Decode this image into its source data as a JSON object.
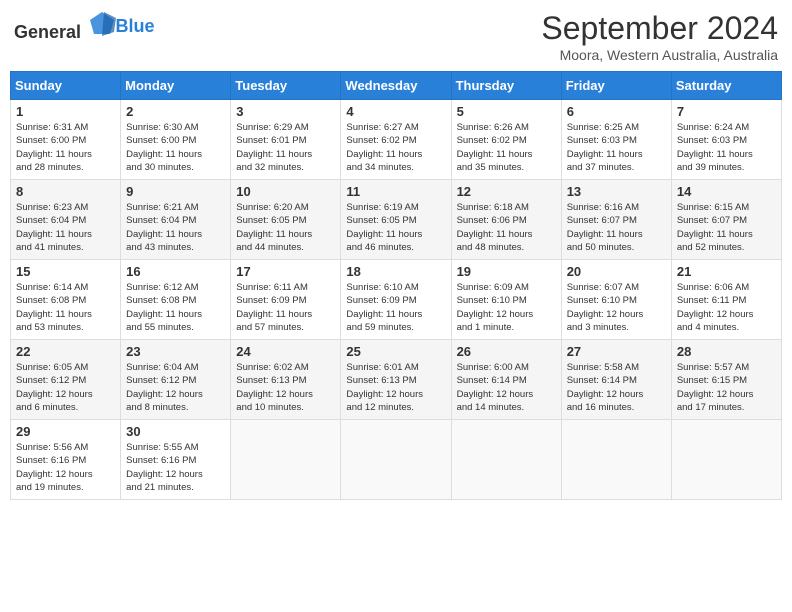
{
  "header": {
    "logo_general": "General",
    "logo_blue": "Blue",
    "month_title": "September 2024",
    "location": "Moora, Western Australia, Australia"
  },
  "weekdays": [
    "Sunday",
    "Monday",
    "Tuesday",
    "Wednesday",
    "Thursday",
    "Friday",
    "Saturday"
  ],
  "weeks": [
    [
      {
        "day": "1",
        "sunrise": "6:31 AM",
        "sunset": "6:00 PM",
        "daylight": "11 hours and 28 minutes."
      },
      {
        "day": "2",
        "sunrise": "6:30 AM",
        "sunset": "6:00 PM",
        "daylight": "11 hours and 30 minutes."
      },
      {
        "day": "3",
        "sunrise": "6:29 AM",
        "sunset": "6:01 PM",
        "daylight": "11 hours and 32 minutes."
      },
      {
        "day": "4",
        "sunrise": "6:27 AM",
        "sunset": "6:02 PM",
        "daylight": "11 hours and 34 minutes."
      },
      {
        "day": "5",
        "sunrise": "6:26 AM",
        "sunset": "6:02 PM",
        "daylight": "11 hours and 35 minutes."
      },
      {
        "day": "6",
        "sunrise": "6:25 AM",
        "sunset": "6:03 PM",
        "daylight": "11 hours and 37 minutes."
      },
      {
        "day": "7",
        "sunrise": "6:24 AM",
        "sunset": "6:03 PM",
        "daylight": "11 hours and 39 minutes."
      }
    ],
    [
      {
        "day": "8",
        "sunrise": "6:23 AM",
        "sunset": "6:04 PM",
        "daylight": "11 hours and 41 minutes."
      },
      {
        "day": "9",
        "sunrise": "6:21 AM",
        "sunset": "6:04 PM",
        "daylight": "11 hours and 43 minutes."
      },
      {
        "day": "10",
        "sunrise": "6:20 AM",
        "sunset": "6:05 PM",
        "daylight": "11 hours and 44 minutes."
      },
      {
        "day": "11",
        "sunrise": "6:19 AM",
        "sunset": "6:05 PM",
        "daylight": "11 hours and 46 minutes."
      },
      {
        "day": "12",
        "sunrise": "6:18 AM",
        "sunset": "6:06 PM",
        "daylight": "11 hours and 48 minutes."
      },
      {
        "day": "13",
        "sunrise": "6:16 AM",
        "sunset": "6:07 PM",
        "daylight": "11 hours and 50 minutes."
      },
      {
        "day": "14",
        "sunrise": "6:15 AM",
        "sunset": "6:07 PM",
        "daylight": "11 hours and 52 minutes."
      }
    ],
    [
      {
        "day": "15",
        "sunrise": "6:14 AM",
        "sunset": "6:08 PM",
        "daylight": "11 hours and 53 minutes."
      },
      {
        "day": "16",
        "sunrise": "6:12 AM",
        "sunset": "6:08 PM",
        "daylight": "11 hours and 55 minutes."
      },
      {
        "day": "17",
        "sunrise": "6:11 AM",
        "sunset": "6:09 PM",
        "daylight": "11 hours and 57 minutes."
      },
      {
        "day": "18",
        "sunrise": "6:10 AM",
        "sunset": "6:09 PM",
        "daylight": "11 hours and 59 minutes."
      },
      {
        "day": "19",
        "sunrise": "6:09 AM",
        "sunset": "6:10 PM",
        "daylight": "12 hours and 1 minute."
      },
      {
        "day": "20",
        "sunrise": "6:07 AM",
        "sunset": "6:10 PM",
        "daylight": "12 hours and 3 minutes."
      },
      {
        "day": "21",
        "sunrise": "6:06 AM",
        "sunset": "6:11 PM",
        "daylight": "12 hours and 4 minutes."
      }
    ],
    [
      {
        "day": "22",
        "sunrise": "6:05 AM",
        "sunset": "6:12 PM",
        "daylight": "12 hours and 6 minutes."
      },
      {
        "day": "23",
        "sunrise": "6:04 AM",
        "sunset": "6:12 PM",
        "daylight": "12 hours and 8 minutes."
      },
      {
        "day": "24",
        "sunrise": "6:02 AM",
        "sunset": "6:13 PM",
        "daylight": "12 hours and 10 minutes."
      },
      {
        "day": "25",
        "sunrise": "6:01 AM",
        "sunset": "6:13 PM",
        "daylight": "12 hours and 12 minutes."
      },
      {
        "day": "26",
        "sunrise": "6:00 AM",
        "sunset": "6:14 PM",
        "daylight": "12 hours and 14 minutes."
      },
      {
        "day": "27",
        "sunrise": "5:58 AM",
        "sunset": "6:14 PM",
        "daylight": "12 hours and 16 minutes."
      },
      {
        "day": "28",
        "sunrise": "5:57 AM",
        "sunset": "6:15 PM",
        "daylight": "12 hours and 17 minutes."
      }
    ],
    [
      {
        "day": "29",
        "sunrise": "5:56 AM",
        "sunset": "6:16 PM",
        "daylight": "12 hours and 19 minutes."
      },
      {
        "day": "30",
        "sunrise": "5:55 AM",
        "sunset": "6:16 PM",
        "daylight": "12 hours and 21 minutes."
      },
      null,
      null,
      null,
      null,
      null
    ]
  ],
  "labels": {
    "sunrise": "Sunrise:",
    "sunset": "Sunset:",
    "daylight": "Daylight:"
  }
}
